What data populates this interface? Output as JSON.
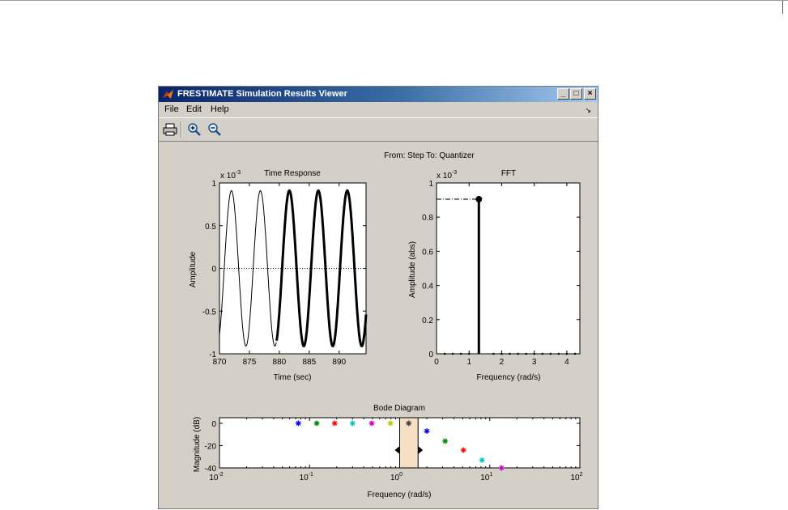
{
  "window": {
    "title": "FRESTIMATE Simulation Results Viewer",
    "controls": {
      "minimize": "_",
      "maximize": "□",
      "close": "×"
    }
  },
  "menu": {
    "items": [
      "File",
      "Edit",
      "Help"
    ]
  },
  "toolbar": {
    "icons": [
      "printer-icon",
      "zoom-in-icon",
      "zoom-out-icon"
    ]
  },
  "figure": {
    "main_title": "From: Step  To: Quantizer"
  },
  "colors": {
    "window_bg": "#d4d0c8",
    "plot_bg": "#ffffff",
    "highlight": "#f7dfc4"
  },
  "chart_data": [
    {
      "type": "line",
      "title": "Time Response",
      "xlabel": "Time (sec)",
      "ylabel": "Amplitude",
      "exponent_label": "x 10",
      "exponent_power": "-3",
      "xlim": [
        870,
        894.5
      ],
      "ylim": [
        -1,
        1
      ],
      "xticks": [
        870,
        875,
        880,
        885,
        890
      ],
      "xtick_labels": [
        "870",
        "875",
        "880",
        "885",
        "890"
      ],
      "yticks": [
        -1,
        -0.5,
        0,
        0.5,
        1
      ],
      "ytick_labels": [
        "-1",
        "-0.5",
        "0",
        "0.5",
        "1"
      ],
      "signal": {
        "amplitude": 0.91,
        "period": 4.84,
        "phase_peak": 872,
        "transient_end": 879.5
      }
    },
    {
      "type": "bar",
      "title": "FFT",
      "xlabel": "Frequency (rad/s)",
      "ylabel": "Amplitude (abs)",
      "exponent_label": "x 10",
      "exponent_power": "-3",
      "xlim": [
        0,
        4.4
      ],
      "ylim": [
        0,
        1
      ],
      "xticks": [
        0,
        1,
        2,
        3,
        4
      ],
      "xtick_labels": [
        "0",
        "1",
        "2",
        "3",
        "4"
      ],
      "yticks": [
        0,
        0.2,
        0.4,
        0.6,
        0.8,
        1
      ],
      "ytick_labels": [
        "0",
        "0.2",
        "0.4",
        "0.6",
        "0.8",
        "1"
      ],
      "stems": [
        {
          "x": 0.25,
          "y": 0
        },
        {
          "x": 0.5,
          "y": 0
        },
        {
          "x": 0.75,
          "y": 0
        },
        {
          "x": 1.0,
          "y": 0
        },
        {
          "x": 1.3,
          "y": 0.905
        },
        {
          "x": 1.75,
          "y": 0
        },
        {
          "x": 2.0,
          "y": 0
        },
        {
          "x": 2.25,
          "y": 0
        },
        {
          "x": 2.5,
          "y": 0
        },
        {
          "x": 2.75,
          "y": 0
        },
        {
          "x": 3.0,
          "y": 0
        },
        {
          "x": 3.25,
          "y": 0
        },
        {
          "x": 3.5,
          "y": 0
        },
        {
          "x": 3.75,
          "y": 0
        },
        {
          "x": 4.0,
          "y": 0
        },
        {
          "x": 4.25,
          "y": 0
        }
      ]
    },
    {
      "type": "scatter",
      "title": "Bode Diagram",
      "xlabel": "Frequency (rad/s)",
      "ylabel": "Magnitude (dB)",
      "xscale": "log",
      "xlim": [
        0.01,
        100
      ],
      "ylim": [
        -40,
        5
      ],
      "xticks": [
        0.01,
        0.1,
        1,
        10,
        100
      ],
      "xtick_base": "10",
      "xtick_exponents": [
        "-2",
        "-1",
        "0",
        "1",
        "2"
      ],
      "yticks": [
        0,
        -20,
        -40
      ],
      "ytick_labels": [
        "0",
        "-20",
        "-40"
      ],
      "highlight_band": [
        1.0,
        1.6
      ],
      "points": [
        {
          "x": 0.075,
          "y": 0,
          "color": "#0000ff"
        },
        {
          "x": 0.12,
          "y": 0,
          "color": "#008000"
        },
        {
          "x": 0.19,
          "y": 0,
          "color": "#ff0000"
        },
        {
          "x": 0.3,
          "y": 0,
          "color": "#00bfbf"
        },
        {
          "x": 0.49,
          "y": 0,
          "color": "#bf00bf"
        },
        {
          "x": 0.79,
          "y": 0,
          "color": "#bfbf00"
        },
        {
          "x": 1.26,
          "y": 0,
          "color": "#404040"
        },
        {
          "x": 2.0,
          "y": -7,
          "color": "#0000ff"
        },
        {
          "x": 3.2,
          "y": -16,
          "color": "#008000"
        },
        {
          "x": 5.1,
          "y": -24,
          "color": "#ff0000"
        },
        {
          "x": 8.2,
          "y": -33,
          "color": "#00bfbf"
        },
        {
          "x": 13.5,
          "y": -40,
          "color": "#bf00bf"
        }
      ]
    }
  ]
}
